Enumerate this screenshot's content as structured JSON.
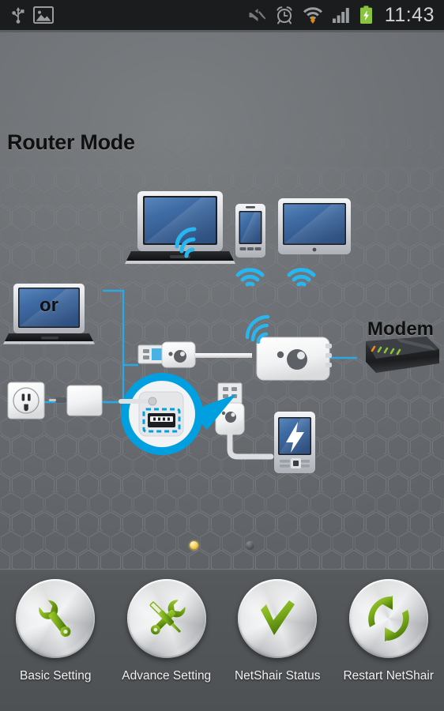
{
  "statusbar": {
    "time": "11:43",
    "left_icons": [
      {
        "name": "usb-icon",
        "label": "USB connected"
      },
      {
        "name": "screenshot-image-icon",
        "label": "Screenshot captured"
      }
    ],
    "right_icons": [
      {
        "name": "mute-icon",
        "label": "Sound muted"
      },
      {
        "name": "alarm-clock-icon",
        "label": "Alarm set"
      },
      {
        "name": "wifi-download-icon",
        "label": "Wi-Fi connected, downloading"
      },
      {
        "name": "cellular-signal-icon",
        "label": "Cellular signal"
      },
      {
        "name": "battery-charging-icon",
        "label": "Battery charging"
      }
    ]
  },
  "wallpaper": {
    "mode_title": "Router Mode",
    "or_label": "or",
    "modem_label": "Modem",
    "devices": [
      {
        "name": "laptop-wireless-client",
        "type": "laptop",
        "wireless": true
      },
      {
        "name": "phone-wireless-client",
        "type": "phone",
        "wireless": true
      },
      {
        "name": "tablet-wireless-client",
        "type": "tablet",
        "wireless": true
      },
      {
        "name": "laptop-usb-power-source",
        "type": "laptop",
        "wireless": false
      },
      {
        "name": "wall-outlet-power-source",
        "type": "outlet",
        "wireless": false
      },
      {
        "name": "power-adapter",
        "type": "adapter",
        "wireless": false
      },
      {
        "name": "netshair-router",
        "type": "router",
        "wireless": true
      },
      {
        "name": "modem",
        "type": "modem",
        "wireless": false
      },
      {
        "name": "charging-phone",
        "type": "phone-charging",
        "wireless": false
      }
    ],
    "callout": {
      "name": "usb-port-zoom-callout",
      "highlight": "usb-port"
    }
  },
  "page_indicator": {
    "total": 2,
    "active_index": 0,
    "active_color": "#f6d560",
    "inactive_color": "#54575a"
  },
  "dock": {
    "items": [
      {
        "label": "Basic Setting",
        "icon": "wrench-icon"
      },
      {
        "label": "Advance Setting",
        "icon": "wrench-screwdriver-icon"
      },
      {
        "label": "NetShair Status",
        "icon": "checkmark-icon"
      },
      {
        "label": "Restart NetShair",
        "icon": "refresh-arrows-icon"
      }
    ]
  },
  "colors": {
    "status_bar_bg": "#1b1c1e",
    "wallpaper_gray": "#6f7276",
    "accent_cyan": "#00a0e0",
    "dock_bg": "#525558",
    "icon_green": "#7ab51d",
    "battery_green": "#8ac43f"
  }
}
